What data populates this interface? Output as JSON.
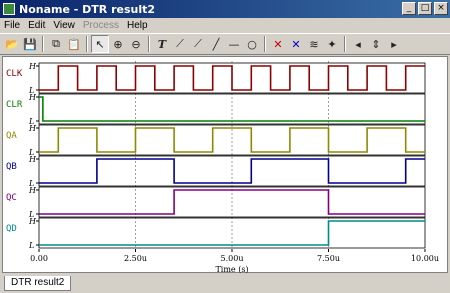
{
  "window": {
    "title": "Noname - DTR result2",
    "min": "_",
    "max": "□",
    "close": "×"
  },
  "menu": {
    "file": "File",
    "edit": "Edit",
    "view": "View",
    "process": "Process",
    "help": "Help"
  },
  "toolbar": {
    "icons": [
      "open-icon",
      "save-icon",
      "copy-icon",
      "paste-icon",
      "pointer-icon",
      "zoom-in-icon",
      "zoom-out-icon",
      "text-icon",
      "cursor-a-icon",
      "cursor-b-icon",
      "line-icon",
      "ellipse-icon",
      "marker-icon",
      "marker2-icon",
      "measure-icon",
      "wand-icon",
      "nav-icon"
    ]
  },
  "tab": {
    "label": "DTR result2"
  },
  "chart_data": {
    "type": "line",
    "xlabel": "Time (s)",
    "xlim": [
      0,
      10
    ],
    "xunit": "u",
    "tick_labels": [
      "0.00",
      "2.50u",
      "5.00u",
      "7.50u",
      "10.00u"
    ],
    "level_labels": {
      "high": "H",
      "low": "L"
    },
    "series": [
      {
        "name": "CLK",
        "color": "#8b0000",
        "initial": 0,
        "transitions": [
          0.5,
          1.0,
          1.5,
          2.0,
          2.5,
          3.0,
          3.5,
          4.0,
          4.5,
          5.0,
          5.5,
          6.0,
          6.5,
          7.0,
          7.5,
          8.0,
          8.5,
          9.0,
          9.5
        ]
      },
      {
        "name": "CLR",
        "color": "#008000",
        "initial": 1,
        "transitions": [
          0.1
        ]
      },
      {
        "name": "QA",
        "color": "#8b8b00",
        "initial": 0,
        "transitions": [
          0.5,
          1.5,
          2.5,
          3.5,
          4.5,
          5.5,
          6.5,
          7.5,
          8.5,
          9.5
        ]
      },
      {
        "name": "QB",
        "color": "#00008b",
        "initial": 0,
        "transitions": [
          1.5,
          3.5,
          5.5,
          7.5,
          9.5
        ]
      },
      {
        "name": "QC",
        "color": "#800080",
        "initial": 0,
        "transitions": [
          3.5,
          7.5
        ]
      },
      {
        "name": "QD",
        "color": "#008b8b",
        "initial": 0,
        "transitions": [
          7.5
        ]
      }
    ]
  }
}
